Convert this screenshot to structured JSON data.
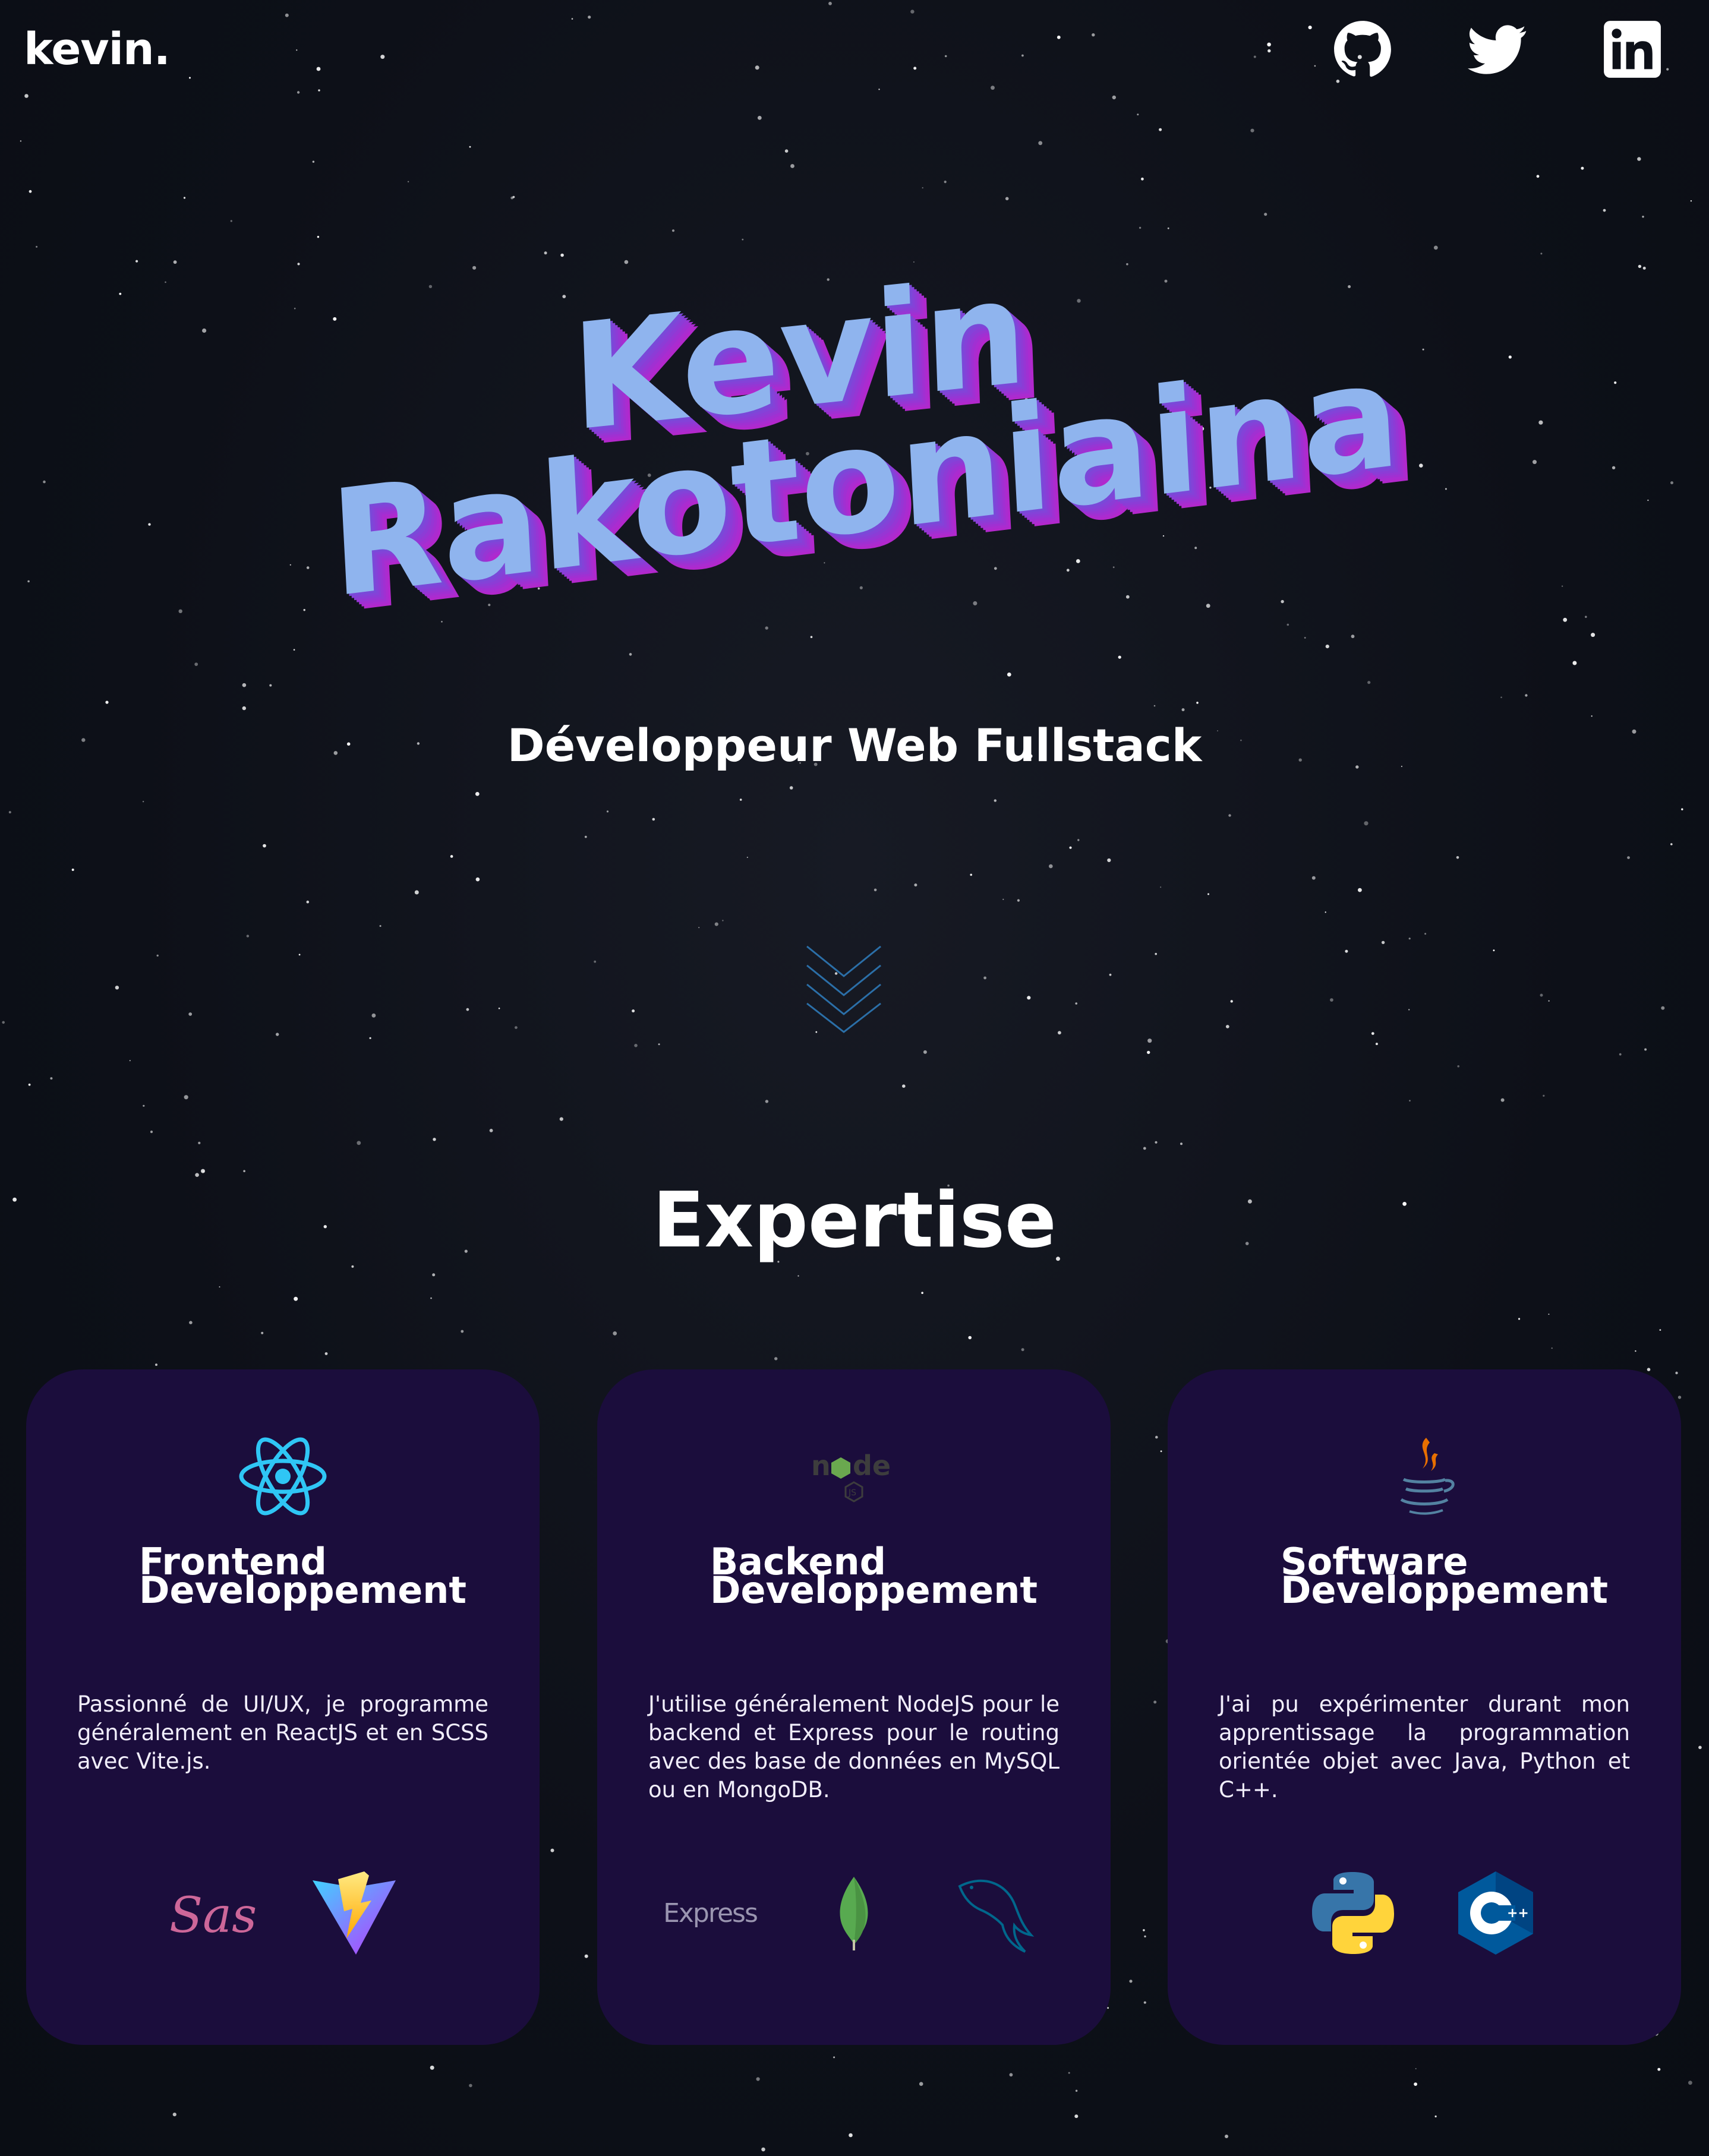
{
  "header": {
    "logo": "kevin.",
    "social": [
      {
        "icon": "github-icon",
        "label": "GitHub"
      },
      {
        "icon": "twitter-icon",
        "label": "Twitter"
      },
      {
        "icon": "linkedin-icon",
        "label": "LinkedIn"
      }
    ]
  },
  "hero": {
    "first_name": "Kevin",
    "last_name": "Rakotoniaina",
    "subtitle": "Développeur Web Fullstack",
    "scroll_icon": "chevrons-down-icon"
  },
  "expertise": {
    "title": "Expertise",
    "cards": [
      {
        "icon": "react-icon",
        "title_line1": "Frontend",
        "title_line2": "Developpement",
        "text": "Passionné de UI/UX, je programme généralement en ReactJS et en SCSS avec Vite.js.",
        "techs": [
          "sass-icon",
          "vite-icon"
        ]
      },
      {
        "icon": "nodejs-icon",
        "title_line1": "Backend",
        "title_line2": "Developpement",
        "text": "J'utilise généralement NodeJS pour le backend et Express pour le routing avec des base de données en MySQL ou en MongoDB.",
        "techs": [
          "express-icon",
          "mongodb-icon",
          "mysql-icon"
        ],
        "express_label": "Express"
      },
      {
        "icon": "java-icon",
        "title_line1": "Software",
        "title_line2": "Developpement",
        "text": "J'ai pu expérimenter durant mon apprentissage la programmation orientée objet avec Java, Python et C++.",
        "techs": [
          "python-icon",
          "cpp-icon"
        ]
      }
    ]
  },
  "colors": {
    "background": "#0d1018",
    "card": "#1b0d3c",
    "hero_face": "#8fb4ee",
    "hero_side": "#a030d2",
    "react": "#2fc6f5",
    "chevron": "#2b6fa8"
  }
}
